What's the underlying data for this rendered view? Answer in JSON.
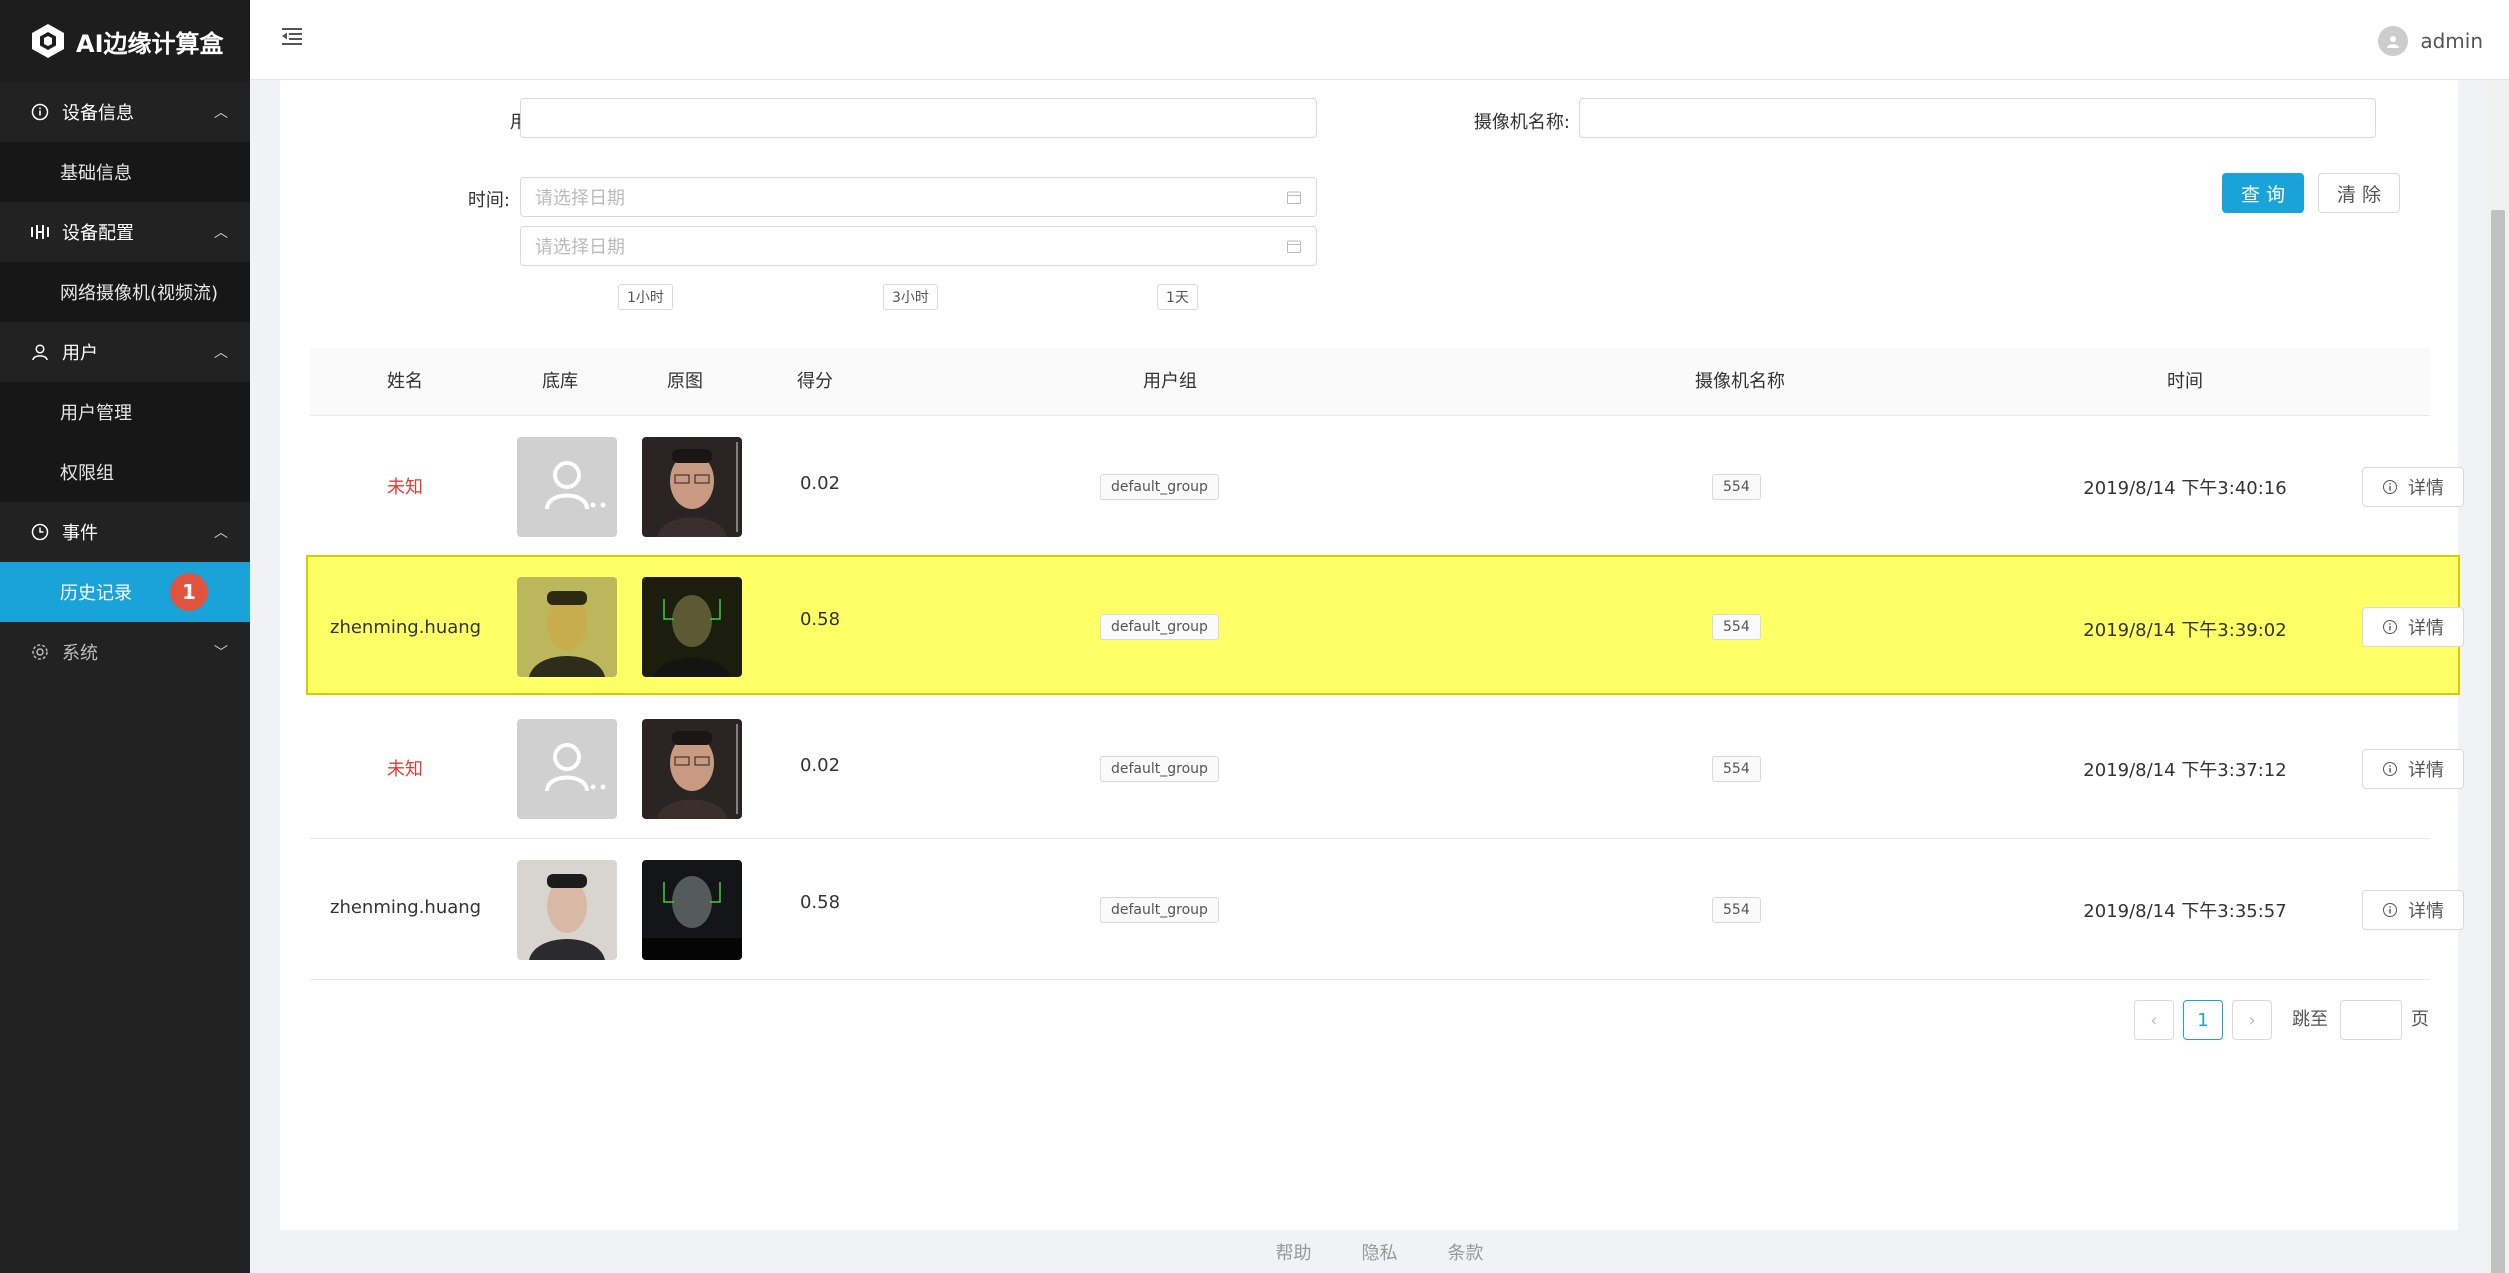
{
  "app": {
    "title": "AI边缘计算盒"
  },
  "user": {
    "name": "admin"
  },
  "sidebar": {
    "groups": [
      {
        "label": "设备信息",
        "items": [
          {
            "label": "基础信息"
          }
        ]
      },
      {
        "label": "设备配置",
        "items": [
          {
            "label": "网络摄像机(视频流)"
          }
        ]
      },
      {
        "label": "用户",
        "items": [
          {
            "label": "用户管理"
          },
          {
            "label": "权限组"
          }
        ]
      },
      {
        "label": "事件",
        "items": [
          {
            "label": "历史记录",
            "badge": "1"
          }
        ]
      },
      {
        "label": "系统",
        "items": []
      }
    ]
  },
  "filters": {
    "user_group_label": "用户组:",
    "user_group_value": "",
    "camera_label": "摄像机名称:",
    "camera_value": "",
    "time_label": "时间:",
    "date_placeholder_start": "请选择日期",
    "date_placeholder_end": "请选择日期",
    "quick": [
      "1小时",
      "3小时",
      "1天"
    ],
    "query_label": "查 询",
    "clear_label": "清 除"
  },
  "table": {
    "headers": {
      "name": "姓名",
      "library": "底库",
      "original": "原图",
      "score": "得分",
      "group": "用户组",
      "camera": "摄像机名称",
      "time": "时间"
    },
    "detail_label": "详情",
    "rows": [
      {
        "name": "未知",
        "unknown": true,
        "score": "0.02",
        "group": "default_group",
        "camera": "554",
        "time": "2019/8/14 下午3:40:16",
        "highlight": false
      },
      {
        "name": "zhenming.huang",
        "unknown": false,
        "score": "0.58",
        "group": "default_group",
        "camera": "554",
        "time": "2019/8/14 下午3:39:02",
        "highlight": true
      },
      {
        "name": "未知",
        "unknown": true,
        "score": "0.02",
        "group": "default_group",
        "camera": "554",
        "time": "2019/8/14 下午3:37:12",
        "highlight": false
      },
      {
        "name": "zhenming.huang",
        "unknown": false,
        "score": "0.58",
        "group": "default_group",
        "camera": "554",
        "time": "2019/8/14 下午3:35:57",
        "highlight": false
      }
    ]
  },
  "pagination": {
    "current": "1",
    "jump_label": "跳至",
    "page_suffix": "页"
  },
  "footer": {
    "links": [
      "帮助",
      "隐私",
      "条款"
    ]
  }
}
